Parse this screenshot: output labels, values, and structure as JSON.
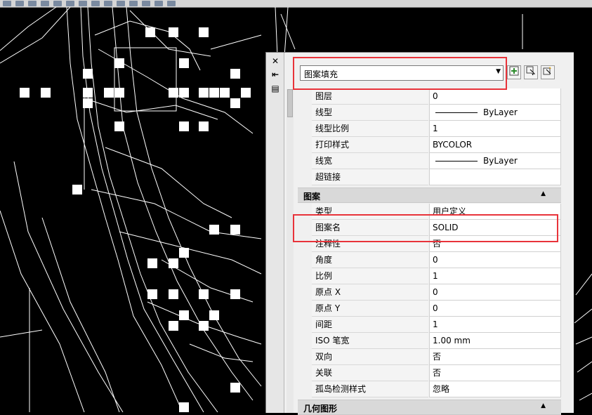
{
  "toolbar": {
    "icons": [
      "new-icon",
      "open-icon",
      "save-icon",
      "plot-icon",
      "undo-icon",
      "redo-icon",
      "pan-icon",
      "zoom-icon",
      "properties-icon",
      "layer-icon",
      "match-icon",
      "measure-icon",
      "zoom-window-icon",
      "zoom-previous-icon"
    ]
  },
  "palette": {
    "close_glyph": "✕",
    "pin_glyph": "⇤",
    "props_glyph": "▤",
    "object_type": "图案填充",
    "buttons": [
      "toggle-pickadd-icon",
      "select-objects-icon",
      "quick-select-icon"
    ],
    "general_rows": [
      {
        "label": "图层",
        "value": "0"
      },
      {
        "label": "线型",
        "value": "ByLayer",
        "line": true
      },
      {
        "label": "线型比例",
        "value": "1"
      },
      {
        "label": "打印样式",
        "value": "BYCOLOR"
      },
      {
        "label": "线宽",
        "value": "ByLayer",
        "line": true
      },
      {
        "label": "超链接",
        "value": ""
      }
    ],
    "pattern_section": {
      "title": "图案",
      "rows": [
        {
          "label": "类型",
          "value": "用户定义"
        },
        {
          "label": "图案名",
          "value": "SOLID"
        },
        {
          "label": "注释性",
          "value": "否"
        },
        {
          "label": "角度",
          "value": "0"
        },
        {
          "label": "比例",
          "value": "1"
        },
        {
          "label": "原点 X",
          "value": "0"
        },
        {
          "label": "原点 Y",
          "value": "0"
        },
        {
          "label": "间距",
          "value": "1"
        },
        {
          "label": "ISO 笔宽",
          "value": "1.00 mm"
        },
        {
          "label": "双向",
          "value": "否"
        },
        {
          "label": "关联",
          "value": "否"
        },
        {
          "label": "孤岛检测样式",
          "value": "忽略"
        }
      ]
    },
    "geometry_section": {
      "title": "几何图形"
    }
  },
  "colors": {
    "highlight": "#e8333a",
    "canvas": "#000000",
    "panel": "#f0f0f0"
  }
}
